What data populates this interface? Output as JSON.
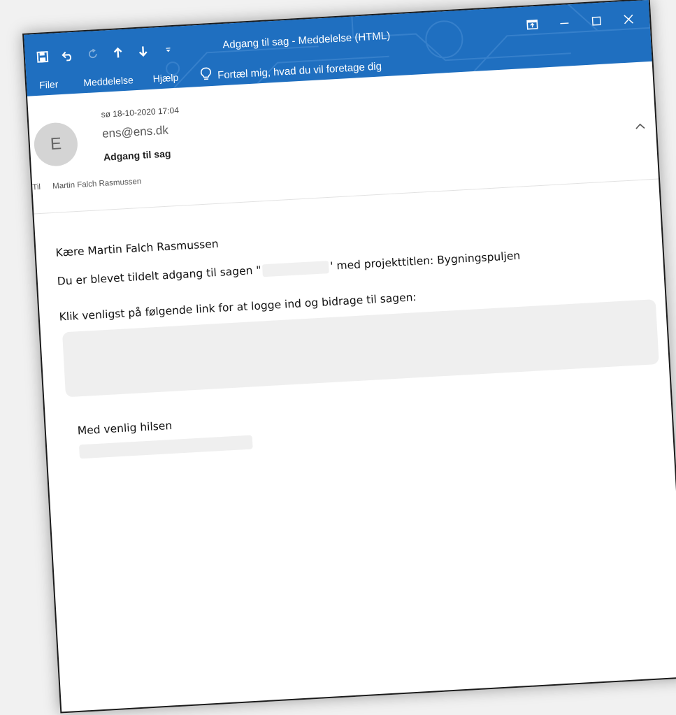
{
  "window": {
    "title": "Adgang til sag  -  Meddelelse (HTML)"
  },
  "quick_access": {
    "icons": [
      "save-icon",
      "undo-icon",
      "redo-icon",
      "previous-item-icon",
      "next-item-icon",
      "customize-qat-icon"
    ]
  },
  "ribbon": {
    "tabs": [
      "Filer",
      "Meddelelse",
      "Hjælp"
    ],
    "tell_me": "Fortæl mig, hvad du vil foretage dig"
  },
  "message": {
    "avatar_initial": "E",
    "date": "sø 18-10-2020 17:04",
    "sender": "ens@ens.dk",
    "subject": "Adgang til sag",
    "to_label": "Til",
    "to_value": "Martin Falch Rasmussen"
  },
  "body": {
    "greeting": "Kære Martin Falch Rasmussen",
    "line2_prefix": "Du er blevet tildelt adgang til sagen \"",
    "line2_suffix": "' med projekttitlen: Bygningspuljen",
    "line3": "Klik venligst på følgende link for at logge ind og bidrage til sagen:",
    "closing": "Med venlig hilsen"
  },
  "colors": {
    "titlebar": "#1f6fc0",
    "page_background": "#f1f1f1",
    "redaction": "#efefef"
  }
}
